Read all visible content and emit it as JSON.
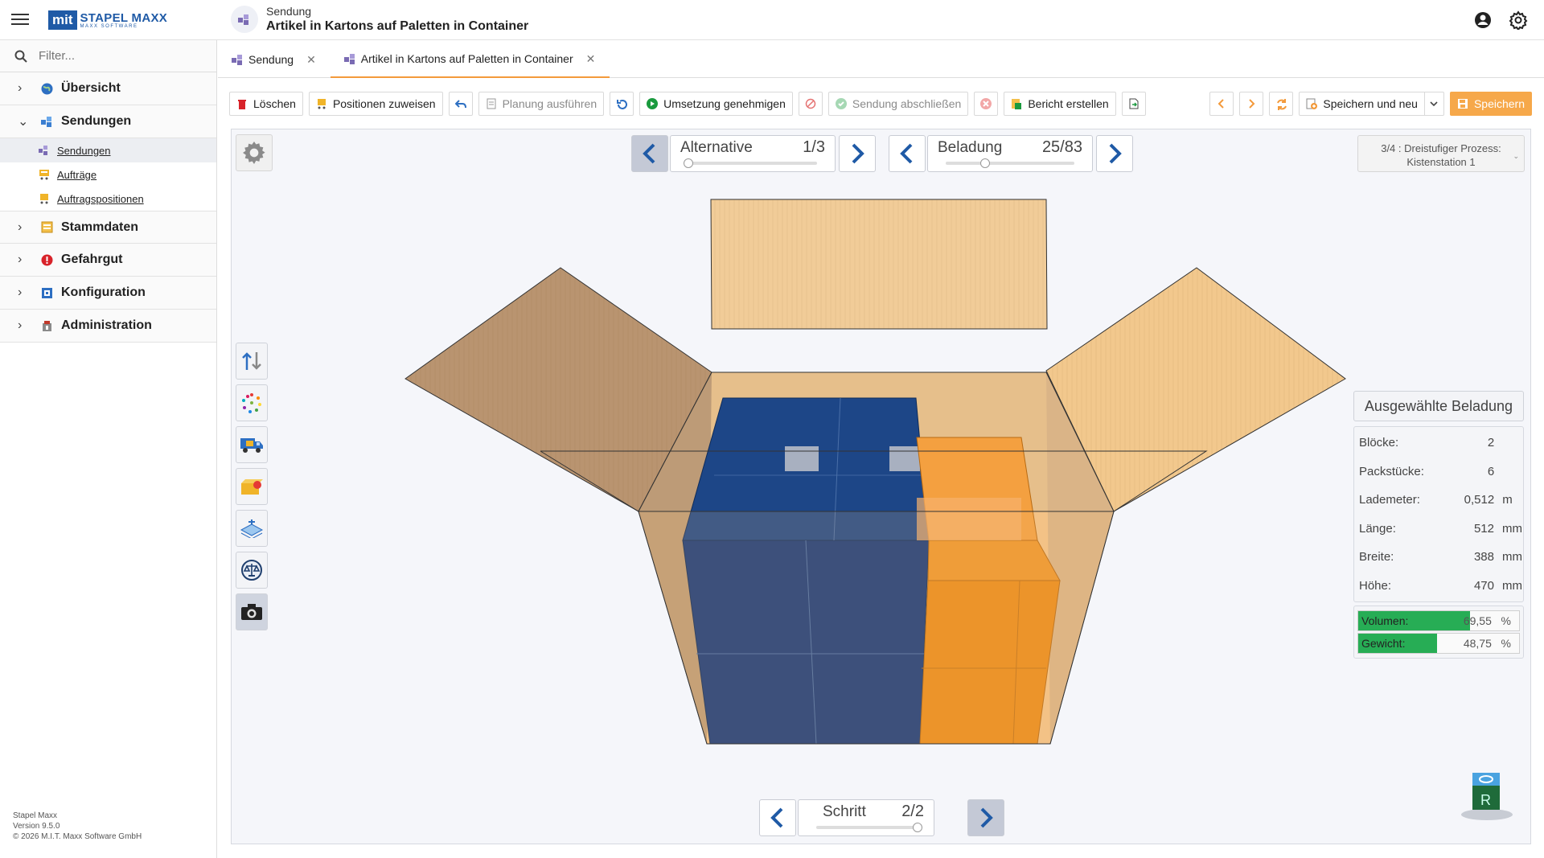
{
  "app": {
    "brand_box": "mit",
    "brand_name": "STAPEL MAXX",
    "brand_sub": "MAXX SOFTWARE",
    "doc_subtitle": "Sendung",
    "doc_title": "Artikel in Kartons auf Paletten in Container"
  },
  "sidebar": {
    "filter_placeholder": "Filter...",
    "items": [
      {
        "label": "Übersicht",
        "icon": "globe-icon"
      },
      {
        "label": "Sendungen",
        "icon": "shipment-icon",
        "expanded": true,
        "children": [
          {
            "label": "Sendungen",
            "icon": "shipment-icon",
            "active": true
          },
          {
            "label": "Aufträge",
            "icon": "order-icon"
          },
          {
            "label": "Auftragspositionen",
            "icon": "order-position-icon"
          }
        ]
      },
      {
        "label": "Stammdaten",
        "icon": "master-data-icon"
      },
      {
        "label": "Gefahrgut",
        "icon": "hazard-icon"
      },
      {
        "label": "Konfiguration",
        "icon": "config-icon"
      },
      {
        "label": "Administration",
        "icon": "admin-icon"
      }
    ],
    "footer": {
      "app": "Stapel Maxx",
      "version": "Version 9.5.0",
      "copyright": "© 2026 M.I.T. Maxx Software GmbH"
    }
  },
  "tabs": [
    {
      "label": "Sendung",
      "active": false
    },
    {
      "label": "Artikel in Kartons auf Paletten in Container",
      "active": true
    }
  ],
  "toolbar": {
    "delete": "Löschen",
    "assign_positions": "Positionen zuweisen",
    "run_planning": "Planung ausführen",
    "approve": "Umsetzung genehmigen",
    "finish_shipment": "Sendung abschließen",
    "create_report": "Bericht erstellen",
    "save_and_new": "Speichern und neu",
    "save": "Speichern"
  },
  "viewer": {
    "alternative": {
      "label": "Alternative",
      "value": "1/3",
      "fraction": 0.0
    },
    "loading": {
      "label": "Beladung",
      "value": "25/83",
      "fraction": 0.3
    },
    "step": {
      "label": "Schritt",
      "value": "2/2",
      "fraction": 1.0
    },
    "process_line1": "3/4 : Dreistufiger Prozess:",
    "process_line2": "Kistenstation 1",
    "logo_letter": "R"
  },
  "selected_loading": {
    "title": "Ausgewählte Beladung",
    "rows": [
      {
        "label": "Blöcke:",
        "value": "2",
        "unit": ""
      },
      {
        "label": "Packstücke:",
        "value": "6",
        "unit": ""
      },
      {
        "label": "Lademeter:",
        "value": "0,512",
        "unit": "m"
      },
      {
        "label": "Länge:",
        "value": "512",
        "unit": "mm"
      },
      {
        "label": "Breite:",
        "value": "388",
        "unit": "mm"
      },
      {
        "label": "Höhe:",
        "value": "470",
        "unit": "mm"
      }
    ],
    "bars": [
      {
        "label": "Volumen:",
        "value": "69,55",
        "unit": "%",
        "fraction": 0.6955
      },
      {
        "label": "Gewicht:",
        "value": "48,75",
        "unit": "%",
        "fraction": 0.4875
      }
    ]
  },
  "colors": {
    "accent": "#f39a3b",
    "brand": "#1f5aa6",
    "save": "#f6a84a",
    "bar": "#27ad55",
    "blue_box": "#1e4a8a",
    "orange_box": "#f0962a"
  }
}
